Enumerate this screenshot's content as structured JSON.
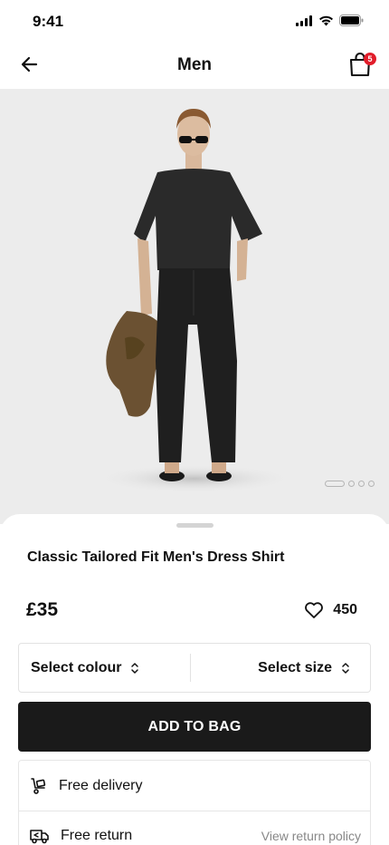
{
  "status_bar": {
    "time": "9:41",
    "icons": [
      "signal-icon",
      "wifi-icon",
      "battery-icon"
    ]
  },
  "nav": {
    "title": "Men",
    "back_icon": "arrow-left-icon",
    "bag_icon": "shopping-bag-icon",
    "bag_count": "5"
  },
  "gallery": {
    "image_count": 4,
    "active_index": 0
  },
  "product": {
    "title": "Classic Tailored Fit Men's Dress Shirt",
    "price": "£35",
    "likes": "450"
  },
  "options": {
    "colour_label": "Select colour",
    "size_label": "Select size"
  },
  "actions": {
    "add_to_bag": "ADD TO BAG"
  },
  "info": {
    "delivery_label": "Free delivery",
    "return_label": "Free return",
    "return_link": "View return policy"
  },
  "colors": {
    "accent": "#1a1a1a",
    "badge": "#e11d2a",
    "hero_bg": "#ececec"
  }
}
